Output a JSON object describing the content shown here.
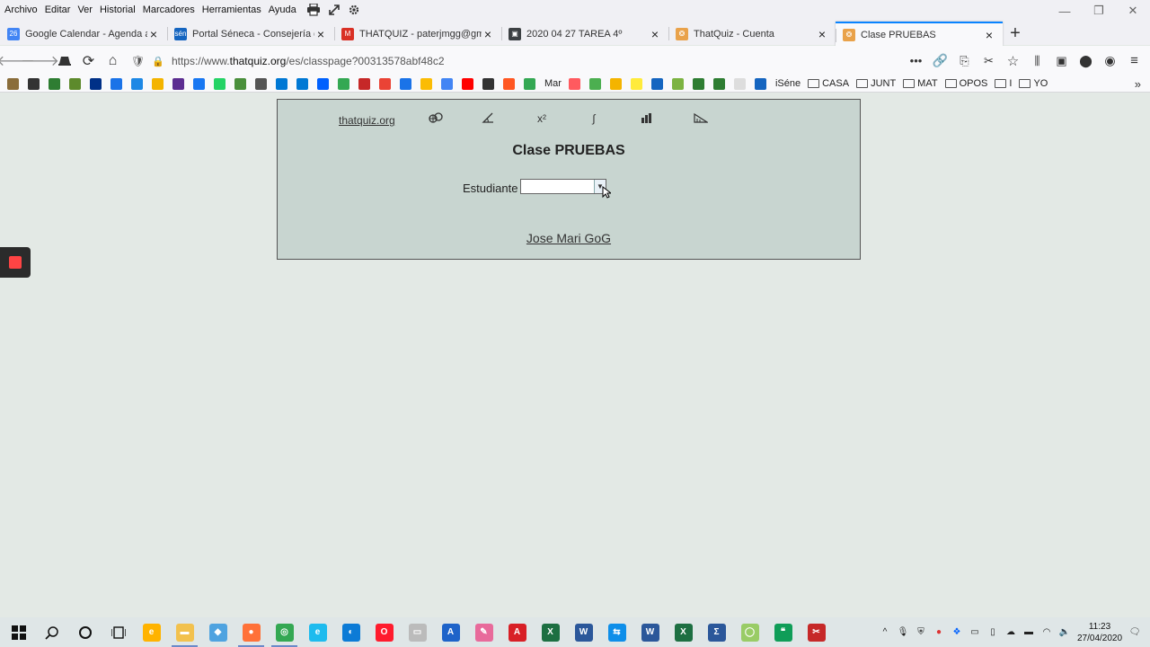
{
  "browser": {
    "menu": [
      "Archivo",
      "Editar",
      "Ver",
      "Historial",
      "Marcadores",
      "Herramientas",
      "Ayuda"
    ],
    "tabs": [
      {
        "title": "Google Calendar - Agenda a p",
        "icon": "calendar-icon",
        "color": "#4285f4",
        "glyph": "26"
      },
      {
        "title": "Portal Séneca - Consejería de E",
        "icon": "seneca-icon",
        "color": "#1565c0",
        "glyph": "sén"
      },
      {
        "title": "THATQUIZ - paterjmgg@gma",
        "icon": "gmail-icon",
        "color": "#d93025",
        "glyph": "M"
      },
      {
        "title": "2020 04 27 TAREA 4º",
        "icon": "classroom-icon",
        "color": "#3c4043",
        "glyph": "▣"
      },
      {
        "title": "ThatQuiz - Cuenta",
        "icon": "thatquiz-icon",
        "color": "#e9a24a",
        "glyph": "❂"
      },
      {
        "title": "Clase PRUEBAS",
        "icon": "thatquiz-icon",
        "color": "#e9a24a",
        "glyph": "❂",
        "active": true
      }
    ],
    "url": {
      "prefix": "https://www.",
      "host": "thatquiz.org",
      "path": "/es/classpage?00313578abf48c2"
    },
    "bookmark_labels": [
      "Mar",
      "iSéne"
    ],
    "bookmark_folders": [
      "CASA",
      "JUNT",
      "MAT",
      "OPOS",
      "I",
      "YO"
    ]
  },
  "page": {
    "site_link": "thatquiz.org",
    "class_title": "Clase PRUEBAS",
    "student_label": "Estudiante",
    "student_select_value": "",
    "teacher_link": "Jose Mari GoG"
  },
  "taskbar": {
    "time": "11:23",
    "date": "27/04/2020"
  }
}
